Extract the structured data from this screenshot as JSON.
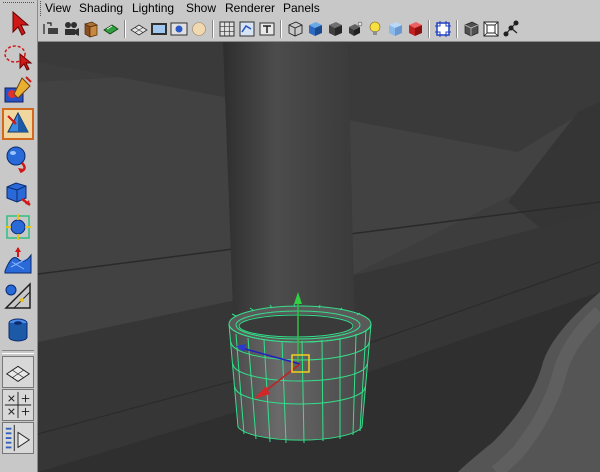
{
  "menu": {
    "items": [
      {
        "label": "View"
      },
      {
        "label": "Shading"
      },
      {
        "label": "Lighting"
      },
      {
        "label": "Show"
      },
      {
        "label": "Renderer"
      },
      {
        "label": "Panels"
      }
    ]
  },
  "toolbox": {
    "tools": [
      {
        "icon": "select-arrow-icon"
      },
      {
        "icon": "lasso-select-icon"
      },
      {
        "icon": "paint-select-icon"
      },
      {
        "icon": "move-tool-icon",
        "active": true
      },
      {
        "icon": "rotate-tool-icon"
      },
      {
        "icon": "scale-tool-icon"
      },
      {
        "icon": "universal-manipulator-icon"
      },
      {
        "icon": "soft-modification-icon"
      },
      {
        "icon": "show-manipulator-icon"
      },
      {
        "icon": "last-tool-used-icon"
      }
    ],
    "layouts": [
      {
        "icon": "single-perspective-layout-icon"
      },
      {
        "icon": "four-view-layout-icon"
      },
      {
        "icon": "outliner-layout-icon"
      }
    ]
  },
  "colors": {
    "active_tool_border": "#d2691e",
    "selection_wire": "#33e08a",
    "viewport_background": "#3b3b3b"
  }
}
